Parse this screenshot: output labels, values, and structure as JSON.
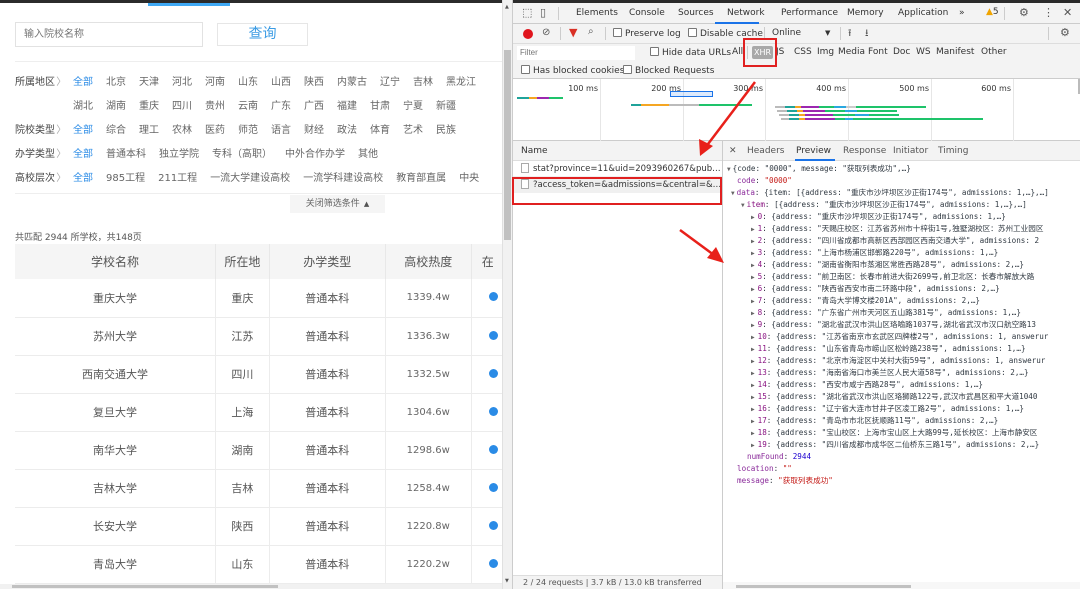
{
  "page": {
    "search": {
      "placeholder": "输入院校名称"
    },
    "query_button": "查询",
    "filters": {
      "region": {
        "label": "所属地区",
        "options": [
          "全部",
          "北京",
          "天津",
          "河北",
          "河南",
          "山东",
          "山西",
          "陕西",
          "内蒙古",
          "辽宁",
          "吉林",
          "黑龙江"
        ],
        "options_row2": [
          "湖北",
          "湖南",
          "重庆",
          "四川",
          "贵州",
          "云南",
          "广东",
          "广西",
          "福建",
          "甘肃",
          "宁夏",
          "新疆"
        ]
      },
      "school_type": {
        "label": "院校类型",
        "options": [
          "全部",
          "综合",
          "理工",
          "农林",
          "医药",
          "师范",
          "语言",
          "财经",
          "政法",
          "体育",
          "艺术",
          "民族"
        ]
      },
      "run_type": {
        "label": "办学类型",
        "options": [
          "全部",
          "普通本科",
          "独立学院",
          "专科（高职）",
          "中外合作办学",
          "其他"
        ]
      },
      "level": {
        "label": "高校层次",
        "options": [
          "全部",
          "985工程",
          "211工程",
          "一流大学建设高校",
          "一流学科建设高校",
          "教育部直属",
          "中央"
        ]
      },
      "active": "全部",
      "close_label": "关闭筛选条件"
    },
    "match_text": "共匹配 2944 所学校，共148页",
    "table": {
      "headers": [
        "学校名称",
        "所在地",
        "办学类型",
        "高校热度",
        "在"
      ],
      "rows": [
        [
          "重庆大学",
          "重庆",
          "普通本科",
          "1339.4w"
        ],
        [
          "苏州大学",
          "江苏",
          "普通本科",
          "1336.3w"
        ],
        [
          "西南交通大学",
          "四川",
          "普通本科",
          "1332.5w"
        ],
        [
          "复旦大学",
          "上海",
          "普通本科",
          "1304.6w"
        ],
        [
          "南华大学",
          "湖南",
          "普通本科",
          "1298.6w"
        ],
        [
          "吉林大学",
          "吉林",
          "普通本科",
          "1258.4w"
        ],
        [
          "长安大学",
          "陕西",
          "普通本科",
          "1220.8w"
        ],
        [
          "青岛大学",
          "山东",
          "普通本科",
          "1220.2w"
        ]
      ]
    }
  },
  "devtools": {
    "tabs": [
      "Elements",
      "Console",
      "Sources",
      "Network",
      "Performance",
      "Memory",
      "Application"
    ],
    "active_tab": "Network",
    "more_tabs": "»",
    "warnings": "5",
    "toolbar": {
      "preserve_log": "Preserve log",
      "disable_cache": "Disable cache",
      "throttle": "Online"
    },
    "filter": {
      "placeholder": "Filter",
      "hide_data_urls": "Hide data URLs",
      "types": [
        "All",
        "XHR",
        "JS",
        "CSS",
        "Img",
        "Media",
        "Font",
        "Doc",
        "WS",
        "Manifest",
        "Other"
      ],
      "active_type": "XHR",
      "has_blocked_cookies": "Has blocked cookies",
      "blocked_requests": "Blocked Requests"
    },
    "timeline": {
      "ticks": [
        "100 ms",
        "200 ms",
        "300 ms",
        "400 ms",
        "500 ms",
        "600 ms"
      ]
    },
    "requests": {
      "header": "Name",
      "items": [
        "stat?province=11&uid=2093960267&publis...",
        "?access_token=&admissions=&central=&de..."
      ],
      "selected": 1,
      "status": "2 / 24 requests  |  3.7 kB / 13.0 kB transferred"
    },
    "detail_tabs": [
      "Headers",
      "Preview",
      "Response",
      "Initiator",
      "Timing"
    ],
    "active_detail_tab": "Preview",
    "preview": {
      "root": "{code: \"0000\", message: \"获取列表成功\",…}",
      "code": "\"0000\"",
      "data_summary": "{item: [{address: \"重庆市沙坪坝区沙正街174号\", admissions: 1,…},…]",
      "item_summary": "[{address: \"重庆市沙坪坝区沙正街174号\", admissions: 1,…},…]",
      "items": [
        "{address: \"重庆市沙坪坝区沙正街174号\", admissions: 1,…}",
        "{address: \"天赐庄校区：江苏省苏州市十梓街1号,独墅湖校区：苏州工业园区",
        "{address: \"四川省成都市高新区西部园区西南交通大学\", admissions: 2",
        "{address: \"上海市杨浦区邯郸路220号\", admissions: 1,…}",
        "{address: \"湖南省衡阳市蒸湘区常胜西路28号\", admissions: 2,…}",
        "{address: \"前卫南区：长春市前进大街2699号,前卫北区：长春市解放大路",
        "{address: \"陕西省西安市南二环路中段\", admissions: 2,…}",
        "{address: \"青岛大学博文楼201A\", admissions: 2,…}",
        "{address: \"广东省广州市天河区五山路381号\", admissions: 1,…}",
        "{address: \"湖北省武汉市洪山区珞喻路1037号,湖北省武汉市汉口航空路13",
        "{address: \"江苏省南京市玄武区四牌楼2号\", admissions: 1, answerur",
        "{address: \"山东省青岛市崂山区松岭路238号\", admissions: 1,…}",
        "{address: \"北京市海淀区中关村大街59号\", admissions: 1, answerur",
        "{address: \"海南省海口市美兰区人民大道58号\", admissions: 2,…}",
        "{address: \"西安市咸宁西路28号\", admissions: 1,…}",
        "{address: \"湖北省武汉市洪山区珞狮路122号,武汉市武昌区和平大道1040",
        "{address: \"辽宁省大连市甘井子区凌工路2号\", admissions: 1,…}",
        "{address: \"青岛市市北区抚顺路11号\", admissions: 2,…}",
        "{address: \"宝山校区：上海市宝山区上大路99号,延长校区：上海市静安区",
        "{address: \"四川省成都市成华区二仙桥东三路1号\", admissions: 2,…}"
      ],
      "numFound": "2944",
      "location": "\"\"",
      "message": "\"获取列表成功\""
    }
  },
  "colors": {
    "accent": "#2a8be6",
    "highlight_red": "#e02020",
    "devtools_blue": "#1a73e8"
  }
}
